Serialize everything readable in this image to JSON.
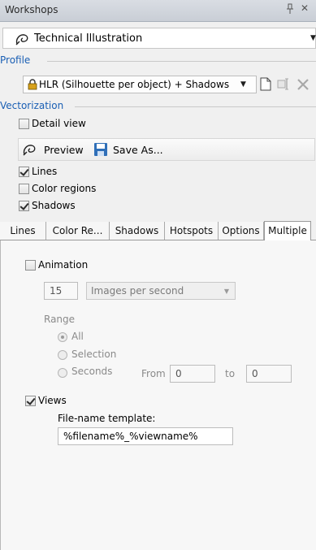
{
  "panel": {
    "title": "Workshops",
    "pin_glyph": "↕",
    "close_glyph": "✕"
  },
  "workshop": {
    "selected": "Technical Illustration",
    "icon": "illustration-swirl-icon"
  },
  "profile": {
    "group_label": "Profile",
    "selected": "HLR (Silhouette per object) + Shadows",
    "lock_icon": "lock-icon"
  },
  "vectorization": {
    "group_label": "Vectorization",
    "detail_view": {
      "label": "Detail view",
      "checked": false
    },
    "preview_label": "Preview",
    "save_as_label": "Save As...",
    "lines": {
      "label": "Lines",
      "checked": true
    },
    "color_regions": {
      "label": "Color regions",
      "checked": false
    },
    "shadows": {
      "label": "Shadows",
      "checked": true
    }
  },
  "tabs": [
    "Lines",
    "Color Re...",
    "Shadows",
    "Hotspots",
    "Options",
    "Multiple"
  ],
  "active_tab": "Multiple",
  "multiple": {
    "animation": {
      "label": "Animation",
      "checked": false
    },
    "fps_value": "15",
    "fps_unit": "Images per second",
    "range_label": "Range",
    "range_all": "All",
    "range_selection": "Selection",
    "range_seconds": "Seconds",
    "from_label": "From",
    "from_value": "0",
    "to_label": "to",
    "to_value": "0",
    "views": {
      "label": "Views",
      "checked": true
    },
    "filename_label": "File-name template:",
    "filename_value": "%filename%_%viewname%"
  },
  "colors": {
    "accent": "#1a5fb4",
    "save_icon": "#2f6fb8"
  }
}
